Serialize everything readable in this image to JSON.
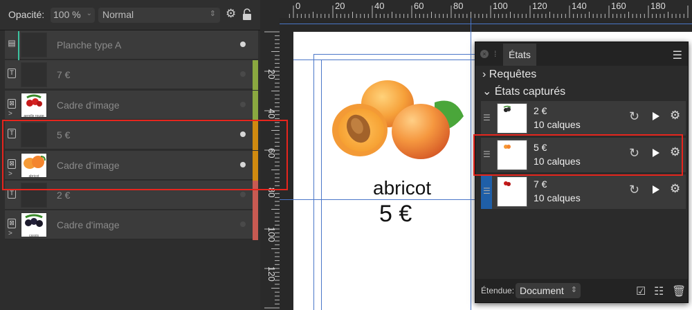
{
  "layers_toolbar": {
    "opacity_label": "Opacité:",
    "opacity_value": "100 %",
    "blend_mode": "Normal",
    "gear_icon": "gear-icon",
    "lock_icon": "lock-icon"
  },
  "layers": [
    {
      "icon": "artboard-icon",
      "type_glyph": "▤",
      "thumb": "dark",
      "name": "Planche type A",
      "visible": true,
      "tag_color": "",
      "expand": ""
    },
    {
      "icon": "text-icon",
      "type_glyph": "T",
      "thumb": "dark",
      "name": "7 €",
      "visible": false,
      "tag_color": "#8aa840",
      "expand": ""
    },
    {
      "icon": "image-frame-icon",
      "type_glyph": "⊠",
      "thumb": "redcurrant",
      "name": "Cadre d'image",
      "visible": false,
      "tag_color": "#8aa840",
      "expand": ">"
    },
    {
      "icon": "text-icon",
      "type_glyph": "T",
      "thumb": "dark",
      "name": "5 €",
      "visible": true,
      "tag_color": "#d08a10",
      "expand": ""
    },
    {
      "icon": "image-frame-icon",
      "type_glyph": "⊠",
      "thumb": "apricot",
      "name": "Cadre d'image",
      "visible": true,
      "tag_color": "#d08a10",
      "expand": ">"
    },
    {
      "icon": "text-icon",
      "type_glyph": "T",
      "thumb": "dark",
      "name": "2 €",
      "visible": false,
      "tag_color": "#c85a52",
      "expand": ""
    },
    {
      "icon": "image-frame-icon",
      "type_glyph": "⊠",
      "thumb": "blackcurrant",
      "name": "Cadre d'image",
      "visible": false,
      "tag_color": "#c85a52",
      "expand": ">"
    }
  ],
  "thumb_captions": {
    "redcurrant": "aerelle rouge",
    "apricot": "abricot",
    "blackcurrant": "cassis"
  },
  "ruler": {
    "unit": "mm",
    "h_ticks": [
      "0",
      "20",
      "40",
      "60",
      "80",
      "100",
      "120",
      "140",
      "160",
      "180"
    ],
    "v_ticks": [
      "20",
      "40",
      "60",
      "80",
      "100",
      "120"
    ]
  },
  "canvas": {
    "fruit_name": "abricot",
    "price": "5 €"
  },
  "states_panel": {
    "tab": "États",
    "section_queries": "Requêtes",
    "section_captured": "États capturés",
    "states": [
      {
        "title": "2 €",
        "layers": "10 calques",
        "handle_color": "#3a3a3a",
        "thumb_fruit": "blackcurrant"
      },
      {
        "title": "5 €",
        "layers": "10 calques",
        "handle_color": "#3a3a3a",
        "thumb_fruit": "apricot"
      },
      {
        "title": "7 €",
        "layers": "10 calques",
        "handle_color": "#1f5fa8",
        "thumb_fruit": "redcurrant"
      }
    ],
    "scope_label": "Étendue:",
    "scope_value": "Document"
  },
  "colors": {
    "highlight": "#e8251d",
    "guide": "#4a76c8",
    "active_handle": "#1f5fa8"
  }
}
